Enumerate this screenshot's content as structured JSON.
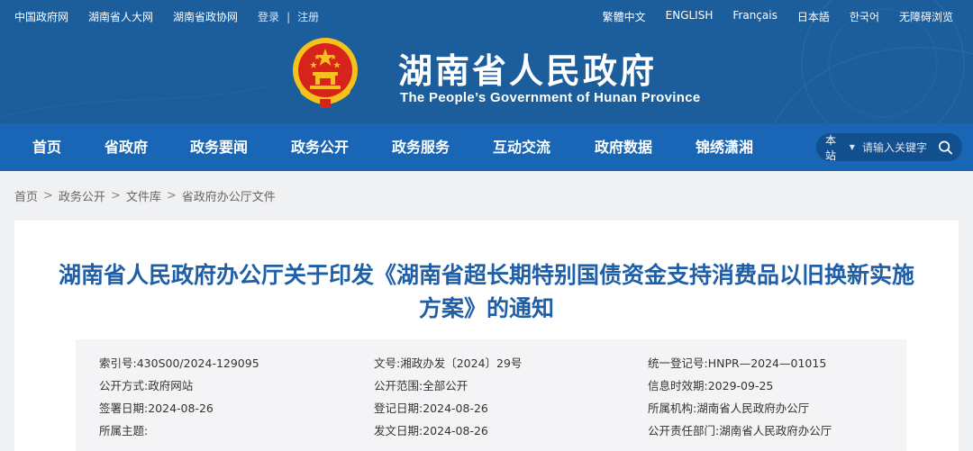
{
  "top_links": {
    "links": [
      "中国政府网",
      "湖南省人大网",
      "湖南省政协网"
    ],
    "login": "登录",
    "separator": "|",
    "register": "注册"
  },
  "languages": [
    "繁體中文",
    "ENGLISH",
    "Français",
    "日本語",
    "한국어",
    "无障碍浏览"
  ],
  "site": {
    "title_zh": "湖南省人民政府",
    "title_en": "The People’s Government of Hunan Province"
  },
  "nav": {
    "items": [
      "首页",
      "省政府",
      "政务要闻",
      "政务公开",
      "政务服务",
      "互动交流",
      "政府数据",
      "锦绣潇湘"
    ],
    "active": "政务公开"
  },
  "search": {
    "scope": "本站",
    "placeholder": "请输入关键字"
  },
  "breadcrumb": [
    "首页",
    "政务公开",
    "文件库",
    "省政府办公厅文件"
  ],
  "document": {
    "title": "湖南省人民政府办公厅关于印发《湖南省超长期特别国债资金支持消费品以旧换新实施方案》的通知",
    "meta": [
      [
        {
          "k": "索引号:",
          "v": "430S00/2024-129095"
        },
        {
          "k": "文号:",
          "v": "湘政办发〔2024〕29号"
        },
        {
          "k": "统一登记号:",
          "v": "HNPR—2024—01015"
        }
      ],
      [
        {
          "k": "公开方式:",
          "v": "政府网站"
        },
        {
          "k": "公开范围:",
          "v": "全部公开"
        },
        {
          "k": "信息时效期:",
          "v": "2029-09-25"
        }
      ],
      [
        {
          "k": "签署日期:",
          "v": "2024-08-26"
        },
        {
          "k": "登记日期:",
          "v": "2024-08-26"
        },
        {
          "k": "所属机构:",
          "v": "湖南省人民政府办公厅"
        }
      ],
      [
        {
          "k": "所属主题:",
          "v": ""
        },
        {
          "k": "发文日期:",
          "v": "2024-08-26"
        },
        {
          "k": "公开责任部门:",
          "v": "湖南省人民政府办公厅"
        }
      ]
    ]
  },
  "colors": {
    "header_bg": "#1d5f9f",
    "nav_bg": "#1866b5",
    "title_blue": "#1f5fa8",
    "emblem_red": "#d6231b",
    "emblem_gold": "#f4c21b"
  }
}
